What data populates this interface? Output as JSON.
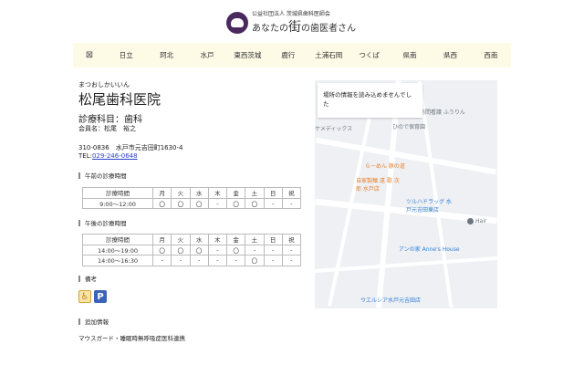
{
  "header": {
    "org": "公益社団法人 茨城県歯科医師会",
    "tag_pre": "あなたの",
    "tag_big": "街",
    "tag_post": "の歯医者さん"
  },
  "nav": {
    "home_icon": "map-grid-icon",
    "items": [
      "日立",
      "珂北",
      "水戸",
      "東西茨城",
      "鹿行",
      "土浦石岡",
      "つくば",
      "県南",
      "県西",
      "西南"
    ]
  },
  "clinic": {
    "kana": "まつおしかいいん",
    "name": "松尾歯科医院",
    "subject": "診療科目：歯科",
    "member": "会員名：松尾　裕之",
    "address": "310-0836　水戸市元吉田町1630-4",
    "tel_label": "TEL:",
    "tel": "029-246-0648"
  },
  "hours": {
    "days": [
      "月",
      "火",
      "水",
      "木",
      "金",
      "土",
      "日",
      "祝"
    ],
    "header": "診療時間",
    "am": {
      "title": "午前の診療時間",
      "rows": [
        {
          "time": "9:00〜12:00",
          "marks": [
            "〇",
            "〇",
            "〇",
            "-",
            "〇",
            "〇",
            "-",
            "-"
          ]
        }
      ]
    },
    "pm": {
      "title": "午後の診療時間",
      "rows": [
        {
          "time": "14:00〜19:00",
          "marks": [
            "〇",
            "〇",
            "〇",
            "-",
            "〇",
            "-",
            "-",
            "-"
          ]
        },
        {
          "time": "14:00〜16:30",
          "marks": [
            "-",
            "-",
            "-",
            "-",
            "-",
            "〇",
            "-",
            "-"
          ]
        }
      ]
    }
  },
  "notes": {
    "title": "備考",
    "icons": [
      "wheelchair-icon",
      "parking-icon"
    ],
    "parking_letter": "P"
  },
  "extra": {
    "title": "追加情報",
    "text": "マウスガード・睡眠時無呼吸症医科連携"
  },
  "map": {
    "error": "場所の情報を読み込めませんでした",
    "labels": [
      "訪問看護 ふうりん",
      "ひので保育園",
      "ケメディックス",
      "らーめん 豚の道",
      "自家製麺 遠 歌 次郎 水戸店",
      "ツルハドラッグ 水戸元吉田東店",
      "アンの家 Anne's House",
      "ウエルシア水戸元吉田店",
      "Hair"
    ],
    "colors": {
      "food": "#e8812e",
      "shop": "#2f7fd8",
      "poi": "#6d7680"
    }
  }
}
